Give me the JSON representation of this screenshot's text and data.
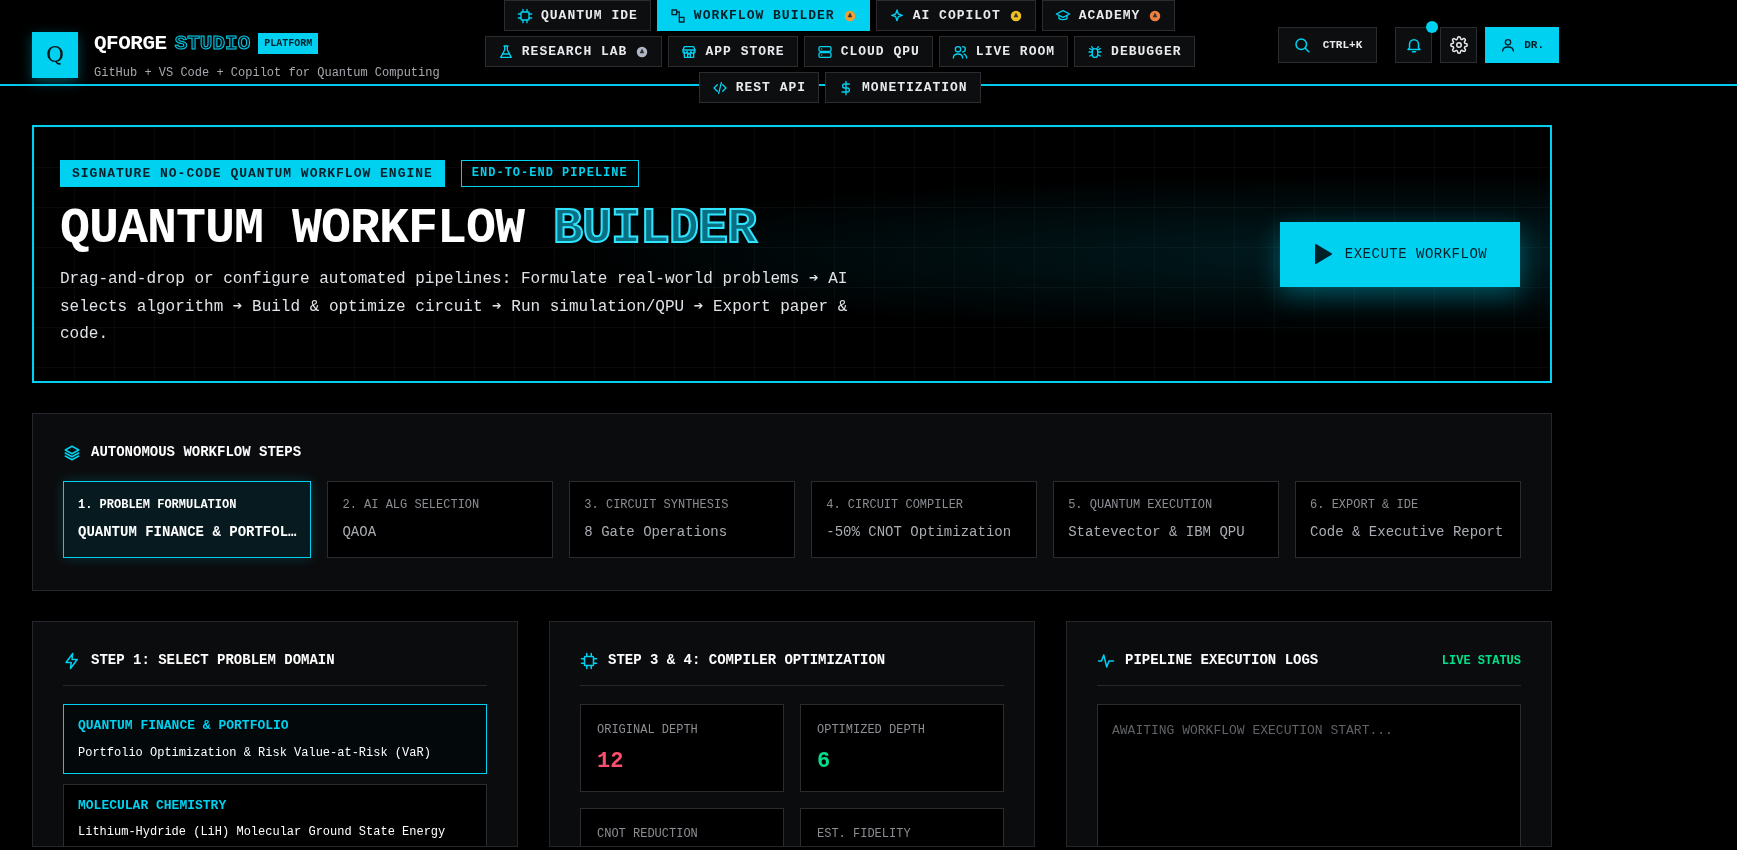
{
  "brand": {
    "logo_letter": "Q",
    "name": "QFORGE",
    "name_accent": "STUDIO",
    "badge": "PLATFORM",
    "tagline": "GitHub + VS Code + Copilot for Quantum Computing"
  },
  "nav_rows": [
    [
      {
        "label": "QUANTUM IDE",
        "selected": false
      },
      {
        "label": "WORKFLOW BUILDER",
        "selected": true
      },
      {
        "label": "AI COPILOT",
        "selected": false
      },
      {
        "label": "ACADEMY",
        "selected": false
      }
    ],
    [
      {
        "label": "RESEARCH LAB",
        "selected": false
      },
      {
        "label": "APP STORE",
        "selected": false
      },
      {
        "label": "CLOUD QPU",
        "selected": false
      },
      {
        "label": "LIVE ROOM",
        "selected": false
      },
      {
        "label": "DEBUGGER",
        "selected": false
      }
    ],
    [
      {
        "label": "REST API",
        "selected": false
      },
      {
        "label": "MONETIZATION",
        "selected": false
      }
    ]
  ],
  "actions": {
    "search_shortcut": "CTRL+K",
    "notifications_unread": true,
    "user": "DR."
  },
  "hero": {
    "tags": [
      {
        "label": "SIGNATURE NO-CODE QUANTUM WORKFLOW ENGINE",
        "kind": "solid"
      },
      {
        "label": "END-TO-END PIPELINE",
        "kind": "outline"
      }
    ],
    "title": "QUANTUM WORKFLOW",
    "title_accent": "BUILDER",
    "description": "Drag-and-drop or configure automated pipelines: Formulate real-world problems ➔ AI selects algorithm ➔ Build & optimize circuit ➔ Run simulation/QPU ➔ Export paper & code.",
    "execute_button": "EXECUTE WORKFLOW"
  },
  "steps_panel": {
    "title": "AUTONOMOUS WORKFLOW STEPS",
    "steps": [
      {
        "label": "1. PROBLEM FORMULATION",
        "value": "QUANTUM FINANCE & PORTFOL…",
        "selected": true
      },
      {
        "label": "2. AI ALG SELECTION",
        "value": "QAOA",
        "selected": false
      },
      {
        "label": "3. CIRCUIT SYNTHESIS",
        "value": "8 Gate Operations",
        "selected": false
      },
      {
        "label": "4. CIRCUIT COMPILER",
        "value": "-50% CNOT Optimization",
        "selected": false
      },
      {
        "label": "5. QUANTUM EXECUTION",
        "value": "Statevector & IBM QPU",
        "selected": false
      },
      {
        "label": "6. EXPORT & IDE",
        "value": "Code & Executive Report",
        "selected": false
      }
    ]
  },
  "domain_panel": {
    "title": "STEP 1: SELECT PROBLEM DOMAIN",
    "domains": [
      {
        "name": "QUANTUM FINANCE & PORTFOLIO",
        "description": "Portfolio Optimization & Risk Value-at-Risk (VaR)",
        "selected": true
      },
      {
        "name": "MOLECULAR CHEMISTRY",
        "description": "Lithium-Hydride (LiH) Molecular Ground State Energy",
        "selected": false
      }
    ]
  },
  "compiler_panel": {
    "title": "STEP 3 & 4: COMPILER OPTIMIZATION",
    "metrics": [
      {
        "label": "ORIGINAL DEPTH",
        "value": "12",
        "color": "#ff4d6d"
      },
      {
        "label": "OPTIMIZED DEPTH",
        "value": "6",
        "color": "#00e08a"
      },
      {
        "label": "CNOT REDUCTION"
      },
      {
        "label": "EST. FIDELITY"
      }
    ]
  },
  "logs_panel": {
    "title": "PIPELINE EXECUTION LOGS",
    "status": "LIVE STATUS",
    "message": "AWAITING WORKFLOW EXECUTION START..."
  }
}
